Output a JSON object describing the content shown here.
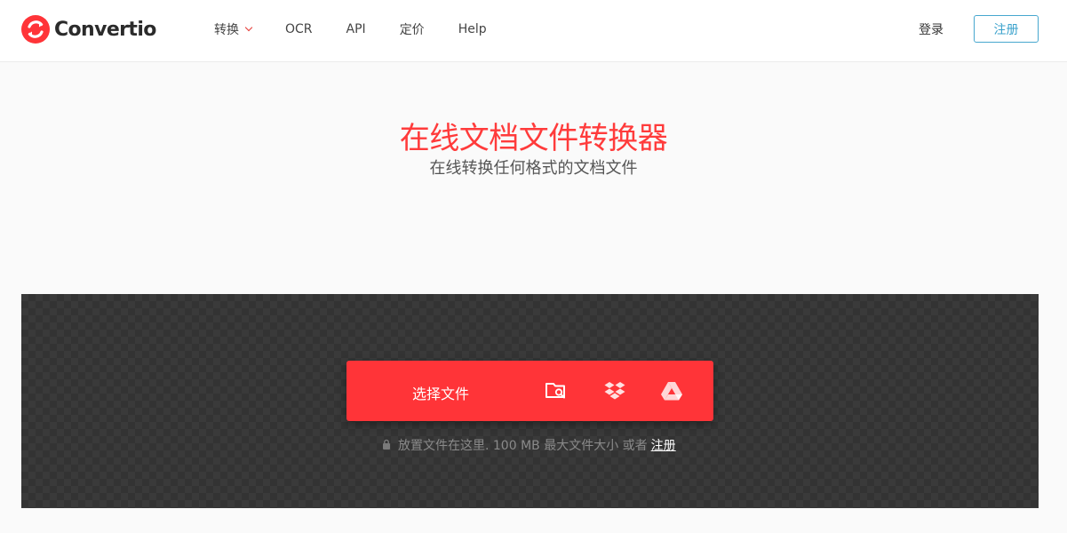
{
  "brand": {
    "name": "Convertio",
    "accent": "#ff3438",
    "logo_icon": "convertio-logo-icon"
  },
  "nav": {
    "items": [
      {
        "label": "转换",
        "has_dropdown": true
      },
      {
        "label": "OCR"
      },
      {
        "label": "API"
      },
      {
        "label": "定价"
      },
      {
        "label": "Help"
      }
    ]
  },
  "auth": {
    "login_label": "登录",
    "signup_label": "注册"
  },
  "hero": {
    "title": "在线文档文件转换器",
    "subtitle": "在线转换任何格式的文档文件"
  },
  "upload": {
    "choose_label": "选择文件",
    "sources": [
      "folder-search-icon",
      "dropbox-icon",
      "google-drive-icon"
    ],
    "hint_text": "放置文件在这里. 100 MB 最大文件大小 或者",
    "hint_link": "注册"
  }
}
